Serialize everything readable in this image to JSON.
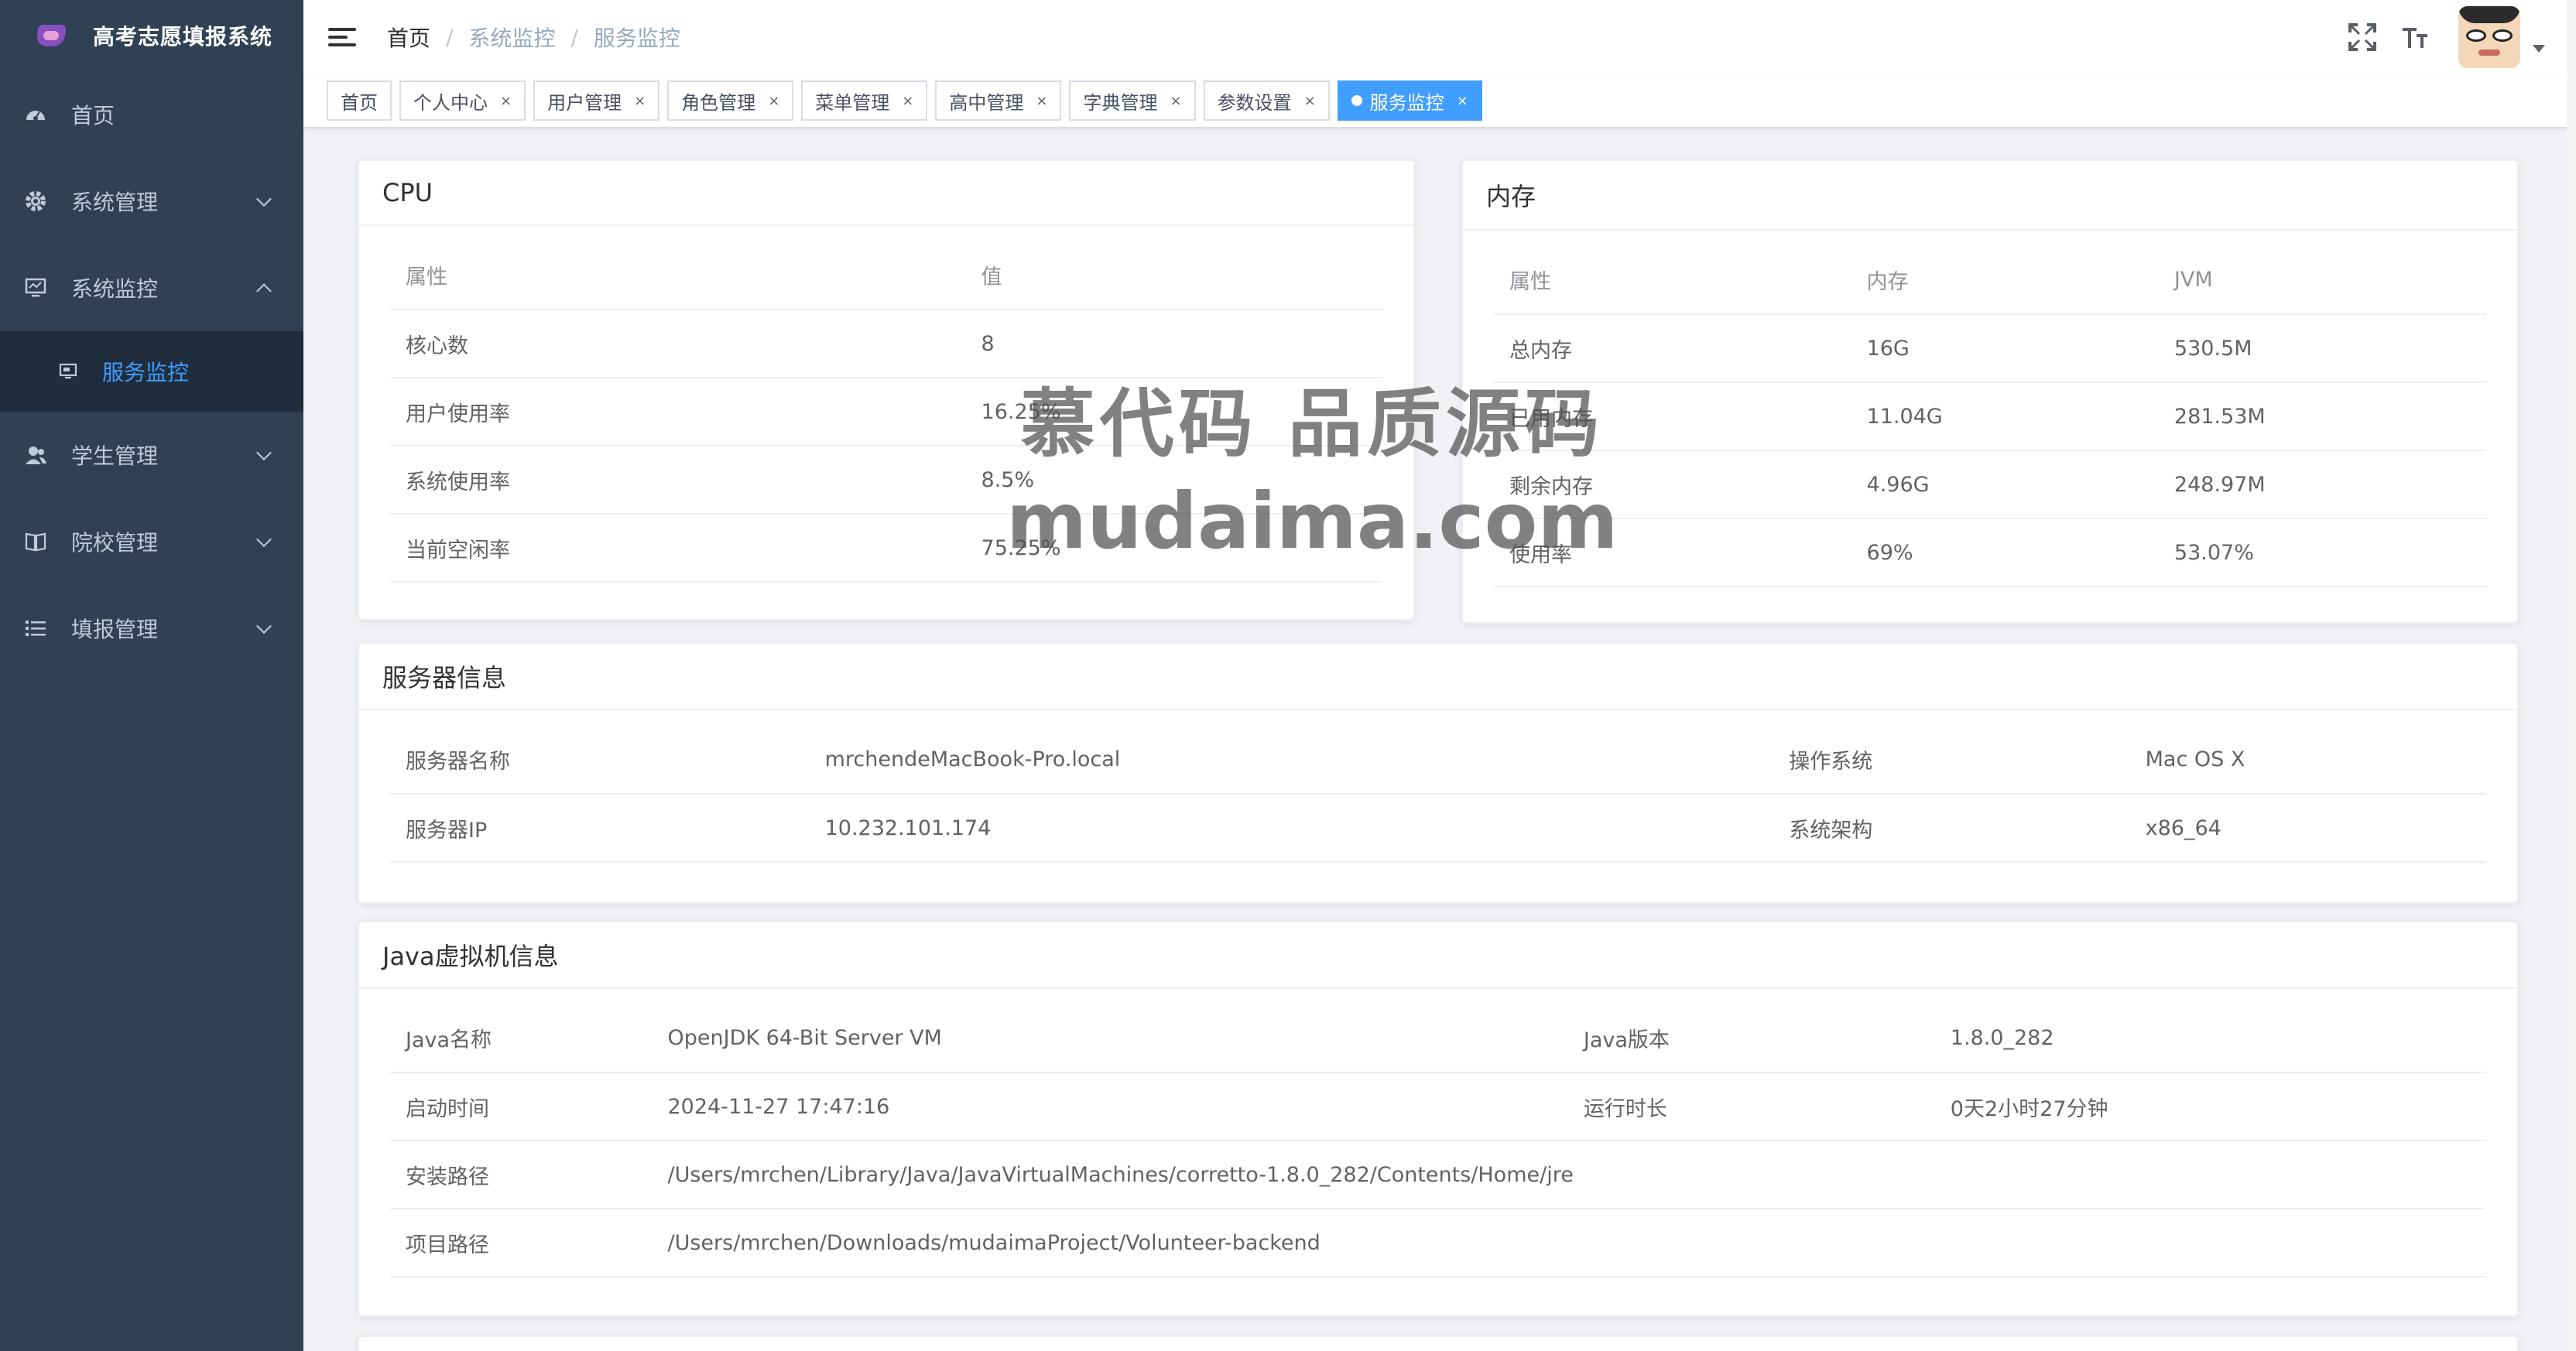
{
  "app": {
    "title": "高考志愿填报系统"
  },
  "sidebar": {
    "items": [
      {
        "label": "首页",
        "icon": "dashboard-icon"
      },
      {
        "label": "系统管理",
        "icon": "gear-icon"
      },
      {
        "label": "系统监控",
        "icon": "monitor-icon",
        "expanded": true
      },
      {
        "label": "学生管理",
        "icon": "user-icon"
      },
      {
        "label": "院校管理",
        "icon": "book-icon"
      },
      {
        "label": "填报管理",
        "icon": "list-icon"
      }
    ],
    "subitem": {
      "label": "服务监控",
      "icon": "server-icon"
    }
  },
  "breadcrumb": [
    "首页",
    "系统监控",
    "服务监控"
  ],
  "tags": [
    "首页",
    "个人中心",
    "用户管理",
    "角色管理",
    "菜单管理",
    "高中管理",
    "字典管理",
    "参数设置",
    "服务监控"
  ],
  "cpu": {
    "title": "CPU",
    "headers": [
      "属性",
      "值"
    ],
    "rows": [
      [
        "核心数",
        "8"
      ],
      [
        "用户使用率",
        "16.25%"
      ],
      [
        "系统使用率",
        "8.5%"
      ],
      [
        "当前空闲率",
        "75.25%"
      ]
    ]
  },
  "mem": {
    "title": "内存",
    "headers": [
      "属性",
      "内存",
      "JVM"
    ],
    "rows": [
      [
        "总内存",
        "16G",
        "530.5M"
      ],
      [
        "已用内存",
        "11.04G",
        "281.53M"
      ],
      [
        "剩余内存",
        "4.96G",
        "248.97M"
      ],
      [
        "使用率",
        "69%",
        "53.07%"
      ]
    ]
  },
  "server": {
    "title": "服务器信息",
    "rows": [
      [
        "服务器名称",
        "mrchendeMacBook-Pro.local",
        "操作系统",
        "Mac OS X"
      ],
      [
        "服务器IP",
        "10.232.101.174",
        "系统架构",
        "x86_64"
      ]
    ]
  },
  "jvm": {
    "title": "Java虚拟机信息",
    "rows": [
      [
        "Java名称",
        "OpenJDK 64-Bit Server VM",
        "Java版本",
        "1.8.0_282"
      ],
      [
        "启动时间",
        "2024-11-27 17:47:16",
        "运行时长",
        "0天2小时27分钟"
      ]
    ],
    "path_rows": [
      [
        "安装路径",
        "/Users/mrchen/Library/Java/JavaVirtualMachines/corretto-1.8.0_282/Contents/Home/jre"
      ],
      [
        "项目路径",
        "/Users/mrchen/Downloads/mudaimaProject/Volunteer-backend"
      ]
    ]
  },
  "watermark": {
    "line1": "慕代码 品质源码",
    "line2": "mudaima.com"
  },
  "colors": {
    "sidebar_bg": "#304156",
    "accent": "#409eff"
  }
}
